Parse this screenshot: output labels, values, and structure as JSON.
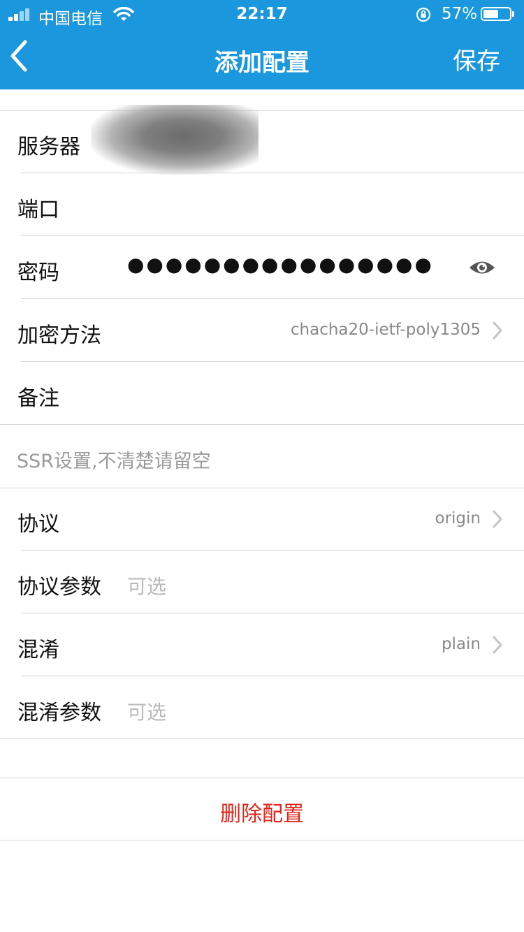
{
  "status_bar": {
    "carrier": "中国电信",
    "time": "22:17",
    "battery_percent": "57%",
    "battery_level": 0.57
  },
  "nav": {
    "title": "添加配置",
    "save_label": "保存",
    "back_icon": "chevron-left-icon"
  },
  "fields": {
    "server": {
      "label": "服务器"
    },
    "port": {
      "label": "端口"
    },
    "password": {
      "label": "密码",
      "dots": "●●●●●●●●●●●●●●●●"
    },
    "encryption": {
      "label": "加密方法",
      "value": "chacha20-ietf-poly1305"
    },
    "remark": {
      "label": "备注"
    }
  },
  "ssr": {
    "section_note": "SSR设置,不清楚请留空",
    "protocol": {
      "label": "协议",
      "value": "origin"
    },
    "protocol_param": {
      "label": "协议参数",
      "placeholder": "可选"
    },
    "obfs": {
      "label": "混淆",
      "value": "plain"
    },
    "obfs_param": {
      "label": "混淆参数",
      "placeholder": "可选"
    }
  },
  "actions": {
    "delete_label": "删除配置"
  },
  "colors": {
    "header_bg": "#1a97dd",
    "delete_red": "#e0251b"
  }
}
